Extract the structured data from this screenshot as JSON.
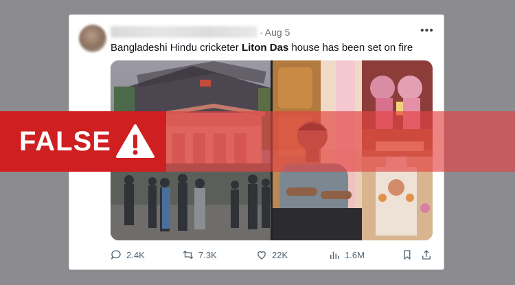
{
  "tweet": {
    "date": "· Aug 5",
    "more_icon": "more-horizontal-icon",
    "text_part1": "Bangladeshi Hindu cricketer ",
    "text_bold": "Liton Das",
    "text_part2": " house has been set on fire"
  },
  "stats": {
    "replies": "2.4K",
    "retweets": "7.3K",
    "likes": "22K",
    "views": "1.6M"
  },
  "fact_check": {
    "verdict": "FALSE",
    "icon": "warning-triangle-icon",
    "label_color": "#cf1f21",
    "band_color": "#e44242"
  }
}
